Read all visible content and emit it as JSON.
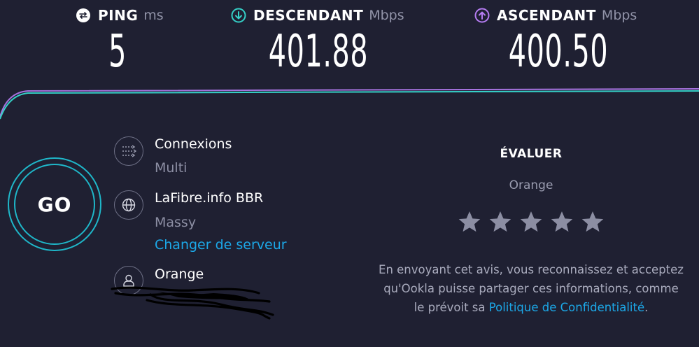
{
  "metrics": {
    "ping": {
      "name": "PING",
      "unit": "ms",
      "value": "5",
      "icon": "ping-gauge-icon",
      "color": "#ffffff"
    },
    "download": {
      "name": "DESCENDANT",
      "unit": "Mbps",
      "value": "401.88",
      "icon": "download-arrow-icon",
      "color": "#35d0c7"
    },
    "upload": {
      "name": "ASCENDANT",
      "unit": "Mbps",
      "value": "400.50",
      "icon": "upload-arrow-icon",
      "color": "#b57cf2"
    }
  },
  "go_button": {
    "label": "GO"
  },
  "connections": {
    "title": "Connexions",
    "value": "Multi",
    "icon": "connections-icon"
  },
  "server": {
    "title": "LaFibre.info BBR",
    "location": "Massy",
    "change_link": "Changer de serveur",
    "icon": "globe-icon"
  },
  "provider": {
    "title": "Orange",
    "icon": "user-icon"
  },
  "rating": {
    "title": "ÉVALUER",
    "isp": "Orange",
    "stars": 5,
    "disclaimer": "En envoyant cet avis, vous reconnaissez et acceptez qu'Ookla puisse partager ces informations, comme le prévoit sa ",
    "policy_link": "Politique de Confidentialité",
    "disclaimer_end": "."
  },
  "colors": {
    "background": "#1f2032",
    "accent_cyan": "#1fb7c9",
    "accent_purple": "#b57cf2",
    "link": "#1ca8e8",
    "star": "#8c8ea3"
  }
}
